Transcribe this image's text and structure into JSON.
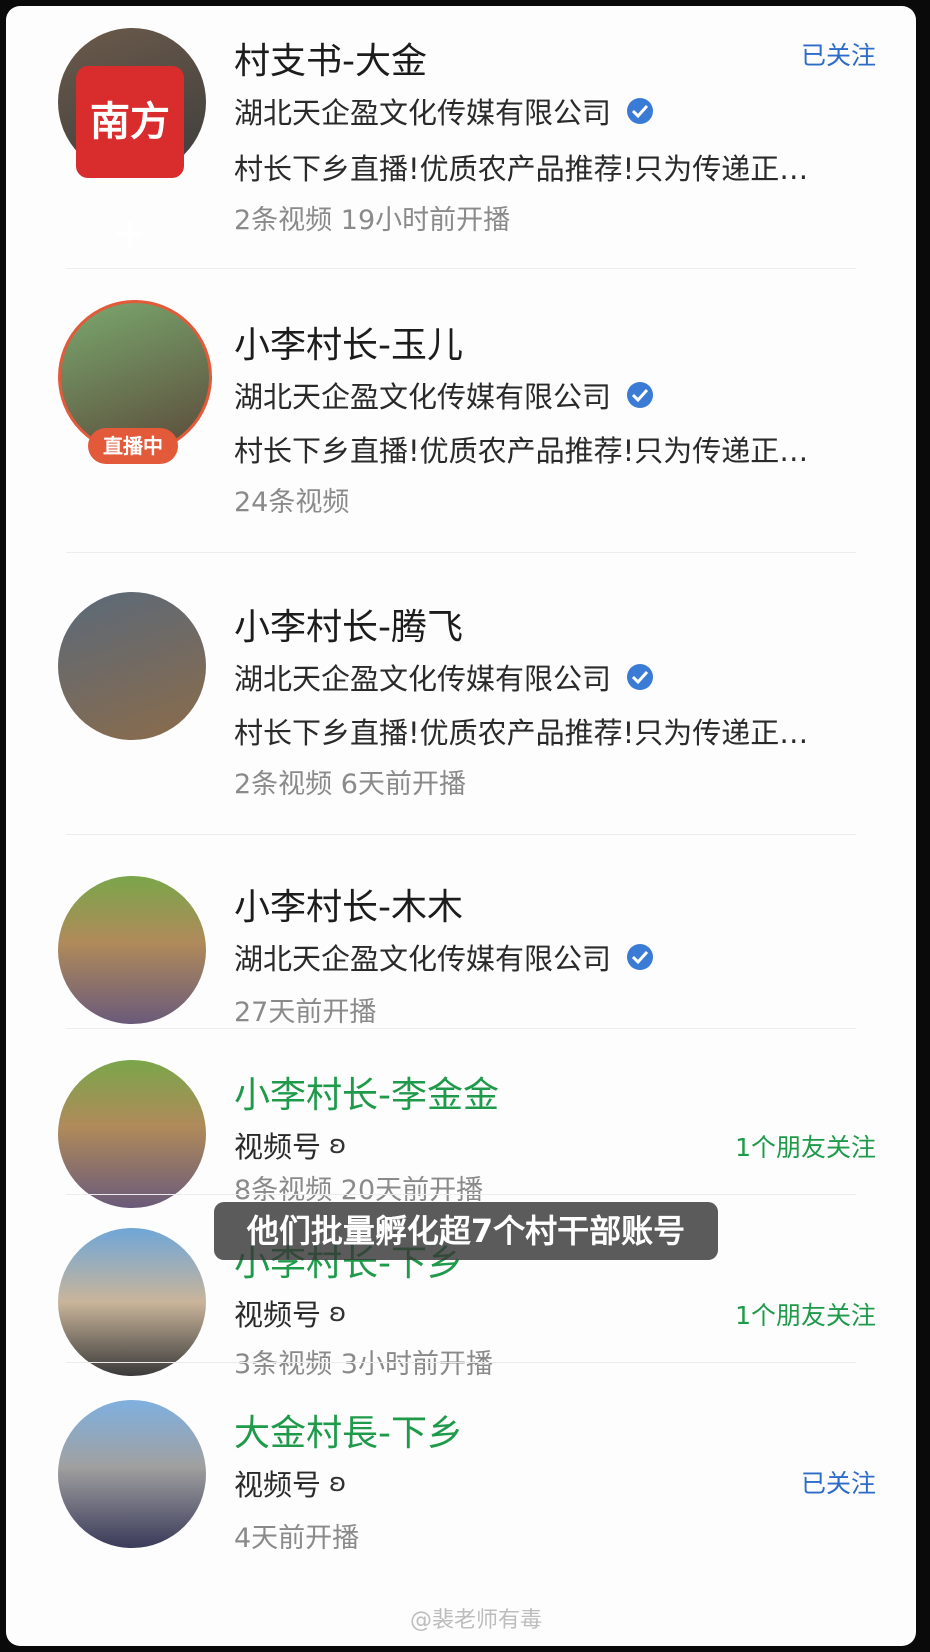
{
  "accounts": [
    {
      "name": "村支书-大金",
      "org": "湖北天企盈文化传媒有限公司",
      "desc": "村长下乡直播!优质农产品推荐!只为传递正…",
      "meta": "2条视频  19小时前开播",
      "follow": "已关注",
      "logo_text": "南方+"
    },
    {
      "name": "小李村长-玉儿",
      "org": "湖北天企盈文化传媒有限公司",
      "desc": "村长下乡直播!优质农产品推荐!只为传递正…",
      "meta": "24条视频",
      "live_badge": "直播中"
    },
    {
      "name": "小李村长-腾飞",
      "org": "湖北天企盈文化传媒有限公司",
      "desc": "村长下乡直播!优质农产品推荐!只为传递正…",
      "meta": "2条视频  6天前开播"
    },
    {
      "name": "小李村长-木木",
      "org": "湖北天企盈文化传媒有限公司",
      "meta": "27天前开播"
    },
    {
      "name": "小李村长-李金金",
      "org": "视频号",
      "meta": "8条视频  20天前开播",
      "follow": "1个朋友关注"
    },
    {
      "name": "小李村长-下乡",
      "org": "视频号",
      "meta": "3条视频  3小时前开播",
      "follow": "1个朋友关注"
    },
    {
      "name": "大金村長-下乡",
      "org": "视频号",
      "meta": "4天前开播",
      "follow": "已关注"
    }
  ],
  "caption": "他们批量孵化超7个村干部账号",
  "watermark": "@裴老师有毒",
  "colors": {
    "accent_blue": "#2d6cc8",
    "wechat_green": "#1e9a4a",
    "live_red": "#e25a3a"
  }
}
